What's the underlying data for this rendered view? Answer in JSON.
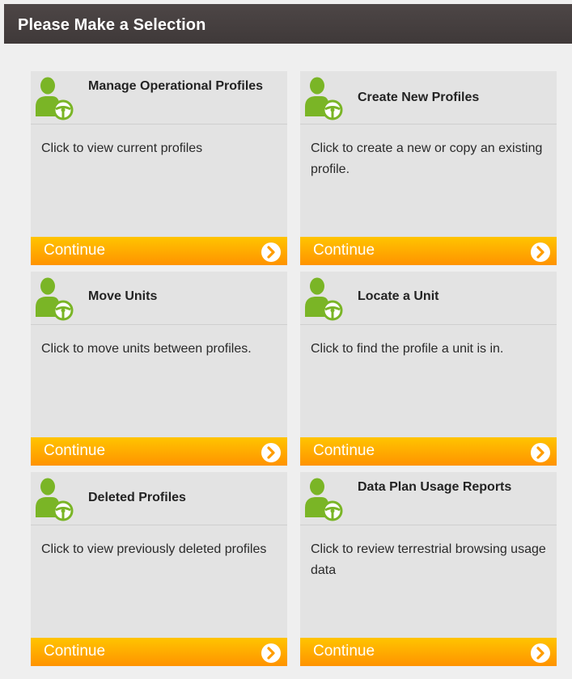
{
  "header": {
    "title": "Please Make a Selection"
  },
  "cards": [
    {
      "title": "Manage Operational Profiles",
      "description": "Click to view current profiles",
      "continue_label": "Continue"
    },
    {
      "title": "Create New Profiles",
      "description": "Click to create a new or copy an existing profile.",
      "continue_label": "Continue"
    },
    {
      "title": "Move Units",
      "description": "Click to move units between profiles.",
      "continue_label": "Continue"
    },
    {
      "title": "Locate a Unit",
      "description": "Click to find the profile a unit is in.",
      "continue_label": "Continue"
    },
    {
      "title": "Deleted Profiles",
      "description": "Click to view previously deleted profiles",
      "continue_label": "Continue"
    },
    {
      "title": "Data Plan Usage Reports",
      "description": "Click to review terrestrial browsing usage data",
      "continue_label": "Continue"
    }
  ],
  "icons": {
    "card_icon": "user-steering-wheel-icon",
    "continue_icon": "chevron-right-circle-icon"
  },
  "colors": {
    "header_bg": "#433d3d",
    "card_bg": "#e3e3e3",
    "continue_top": "#ffc400",
    "continue_bottom": "#ff9300",
    "icon_green": "#7ab526"
  }
}
